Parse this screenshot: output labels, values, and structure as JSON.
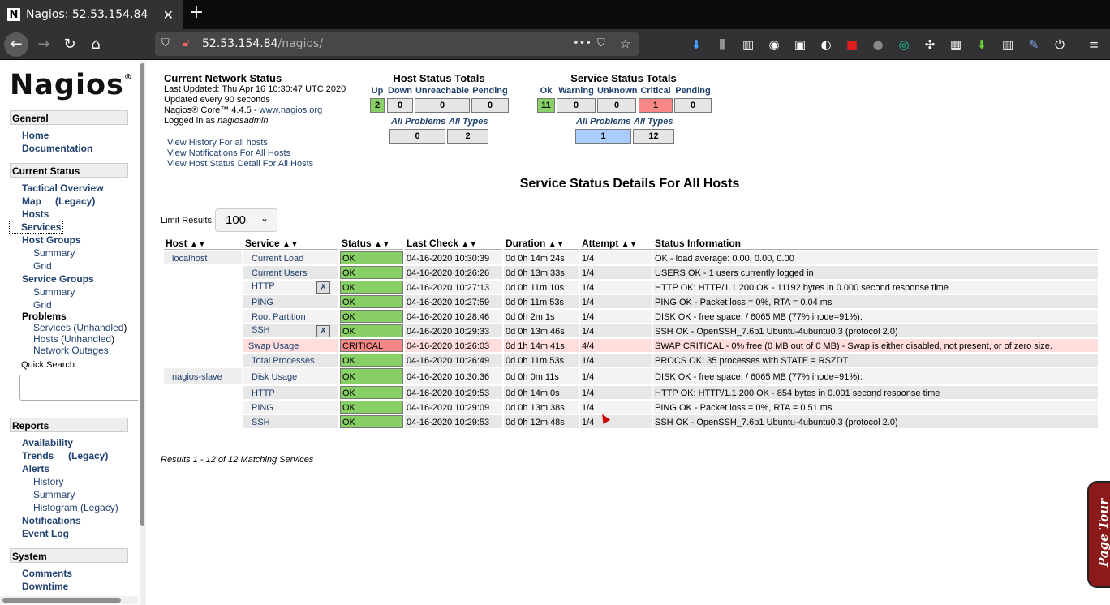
{
  "browser": {
    "tab_title": "Nagios: 52.53.154.84",
    "favicon": "N",
    "url_host": "52.53.154.84",
    "url_path": "/nagios/"
  },
  "sidebar": {
    "logo": "Nagios",
    "logo_mark": "®",
    "general": "General",
    "home": "Home",
    "documentation": "Documentation",
    "current_status": "Current Status",
    "tactical": "Tactical Overview",
    "map": "Map",
    "map_legacy": "(Legacy)",
    "hosts": "Hosts",
    "services": "Services",
    "host_groups": "Host Groups",
    "hg_summary": "Summary",
    "hg_grid": "Grid",
    "service_groups": "Service Groups",
    "sg_summary": "Summary",
    "sg_grid": "Grid",
    "problems": "Problems",
    "p_services": "Services",
    "p_unhandled": "Unhandled",
    "p_hosts": "Hosts",
    "p_hosts_unhandled": "Unhandled",
    "network_outages": "Network Outages",
    "quick_search": "Quick Search:",
    "reports": "Reports",
    "availability": "Availability",
    "trends": "Trends",
    "trends_legacy": "(Legacy)",
    "alerts": "Alerts",
    "history": "History",
    "summary": "Summary",
    "histogram": "Histogram (Legacy)",
    "notifications": "Notifications",
    "event_log": "Event Log",
    "system": "System",
    "comments": "Comments",
    "downtime": "Downtime"
  },
  "network_status": {
    "title": "Current Network Status",
    "updated": "Last Updated: Thu Apr 16 10:30:47 UTC 2020",
    "interval": "Updated every 90 seconds",
    "core_prefix": "Nagios® Core™ 4.4.5 - ",
    "core_link": "www.nagios.org",
    "logged_prefix": "Logged in as ",
    "user": "nagiosadmin",
    "link_history": "View History For all hosts",
    "link_notifications": "View Notifications For All Hosts",
    "link_host_detail": "View Host Status Detail For All Hosts"
  },
  "host_totals": {
    "title": "Host Status Totals",
    "headers": [
      "Up",
      "Down",
      "Unreachable",
      "Pending"
    ],
    "values": [
      "2",
      "0",
      "0",
      "0"
    ],
    "all_problems": "All Problems",
    "all_types": "All Types",
    "problems_value": "0",
    "types_value": "2"
  },
  "service_totals": {
    "title": "Service Status Totals",
    "headers": [
      "Ok",
      "Warning",
      "Unknown",
      "Critical",
      "Pending"
    ],
    "values": [
      "11",
      "0",
      "0",
      "1",
      "0"
    ],
    "all_problems": "All Problems",
    "all_types": "All Types",
    "problems_value": "1",
    "types_value": "12"
  },
  "details": {
    "title": "Service Status Details For All Hosts",
    "limit_label": "Limit Results:",
    "limit_value": "100",
    "columns": [
      "Host",
      "Service",
      "Status",
      "Last Check",
      "Duration",
      "Attempt",
      "Status Information"
    ],
    "rows": [
      {
        "host": "localhost",
        "service": "Current Load",
        "status": "OK",
        "last_check": "04-16-2020 10:30:39",
        "duration": "0d 0h 14m 24s",
        "attempt": "1/4",
        "info": "OK - load average: 0.00, 0.00, 0.00"
      },
      {
        "host": "",
        "service": "Current Users",
        "status": "OK",
        "last_check": "04-16-2020 10:26:26",
        "duration": "0d 0h 13m 33s",
        "attempt": "1/4",
        "info": "USERS OK - 1 users currently logged in"
      },
      {
        "host": "",
        "service": "HTTP",
        "status": "OK",
        "last_check": "04-16-2020 10:27:13",
        "duration": "0d 0h 11m 10s",
        "attempt": "1/4",
        "info": "HTTP OK: HTTP/1.1 200 OK - 11192 bytes in 0.000 second response time"
      },
      {
        "host": "",
        "service": "PING",
        "status": "OK",
        "last_check": "04-16-2020 10:27:59",
        "duration": "0d 0h 11m 53s",
        "attempt": "1/4",
        "info": "PING OK - Packet loss = 0%, RTA = 0.04 ms"
      },
      {
        "host": "",
        "service": "Root Partition",
        "status": "OK",
        "last_check": "04-16-2020 10:28:46",
        "duration": "0d 0h 2m 1s",
        "attempt": "1/4",
        "info": "DISK OK - free space: / 6065 MB (77% inode=91%):"
      },
      {
        "host": "",
        "service": "SSH",
        "status": "OK",
        "last_check": "04-16-2020 10:29:33",
        "duration": "0d 0h 13m 46s",
        "attempt": "1/4",
        "info": "SSH OK - OpenSSH_7.6p1 Ubuntu-4ubuntu0.3 (protocol 2.0)"
      },
      {
        "host": "",
        "service": "Swap Usage",
        "status": "CRITICAL",
        "last_check": "04-16-2020 10:26:03",
        "duration": "0d 1h 14m 41s",
        "attempt": "4/4",
        "info": "SWAP CRITICAL - 0% free (0 MB out of 0 MB) - Swap is either disabled, not present, or of zero size."
      },
      {
        "host": "",
        "service": "Total Processes",
        "status": "OK",
        "last_check": "04-16-2020 10:26:49",
        "duration": "0d 0h 11m 53s",
        "attempt": "1/4",
        "info": "PROCS OK: 35 processes with STATE = RSZDT"
      },
      {
        "host": "nagios-slave",
        "service": "Disk Usage",
        "status": "OK",
        "last_check": "04-16-2020 10:30:36",
        "duration": "0d 0h 0m 11s",
        "attempt": "1/4",
        "info": "DISK OK - free space: / 6065 MB (77% inode=91%):"
      },
      {
        "host": "",
        "service": "HTTP",
        "status": "OK",
        "last_check": "04-16-2020 10:29:53",
        "duration": "0d 0h 14m 0s",
        "attempt": "1/4",
        "info": "HTTP OK: HTTP/1.1 200 OK - 854 bytes in 0.001 second response time"
      },
      {
        "host": "",
        "service": "PING",
        "status": "OK",
        "last_check": "04-16-2020 10:29:09",
        "duration": "0d 0h 13m 38s",
        "attempt": "1/4",
        "info": "PING OK - Packet loss = 0%, RTA = 0.51 ms"
      },
      {
        "host": "",
        "service": "SSH",
        "status": "OK",
        "last_check": "04-16-2020 10:29:53",
        "duration": "0d 0h 12m 48s",
        "attempt": "1/4",
        "info": "SSH OK - OpenSSH_7.6p1 Ubuntu-4ubuntu0.3 (protocol 2.0)"
      }
    ],
    "results": "Results 1 - 12 of 12 Matching Services"
  },
  "page_tour": "Page Tour"
}
